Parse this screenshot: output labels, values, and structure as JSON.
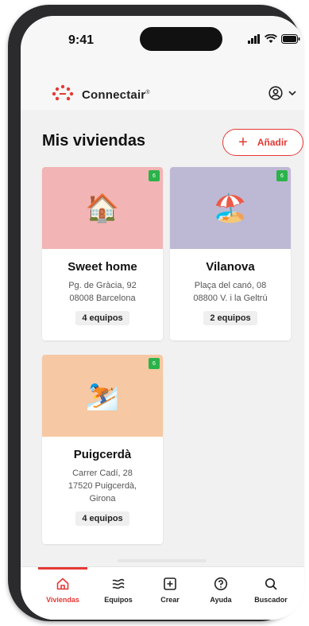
{
  "status_bar": {
    "time": "9:41"
  },
  "header": {
    "brand": "Connectair",
    "brand_mark": "®",
    "account_icon": "user-circle-icon"
  },
  "page": {
    "title": "Mis viviendas",
    "add_button": {
      "icon": "plus",
      "label": "Añadir"
    }
  },
  "homes": [
    {
      "name": "Sweet home",
      "address_line1": "Pg. de Gràcia, 92",
      "address_line2": "08008 Barcelona",
      "address_line3": "",
      "devices": "4 equipos",
      "emoji": "🏠",
      "image_color": "#f2b4b4",
      "badge": "6"
    },
    {
      "name": "Vilanova",
      "address_line1": "Plaça del canó, 08",
      "address_line2": "08800 V. i la Geltrú",
      "address_line3": "",
      "devices": "2 equipos",
      "emoji": "🏖️",
      "image_color": "#bdb9d4",
      "badge": "6"
    },
    {
      "name": "Puigcerdà",
      "address_line1": "Carrer Cadí, 28",
      "address_line2": "17520 Puigcerdà,",
      "address_line3": "Girona",
      "devices": "4 equipos",
      "emoji": "⛷️",
      "image_color": "#f6c8a3",
      "badge": "6"
    }
  ],
  "tabs": [
    {
      "label": "Viviendas",
      "icon": "home-icon",
      "active": true
    },
    {
      "label": "Equipos",
      "icon": "wind-icon",
      "active": false
    },
    {
      "label": "Crear",
      "icon": "plus-square-icon",
      "active": false
    },
    {
      "label": "Ayuda",
      "icon": "help-icon",
      "active": false
    },
    {
      "label": "Buscador",
      "icon": "search-icon",
      "active": false
    }
  ],
  "colors": {
    "accent": "#e53935",
    "badge": "#2bb34a"
  }
}
